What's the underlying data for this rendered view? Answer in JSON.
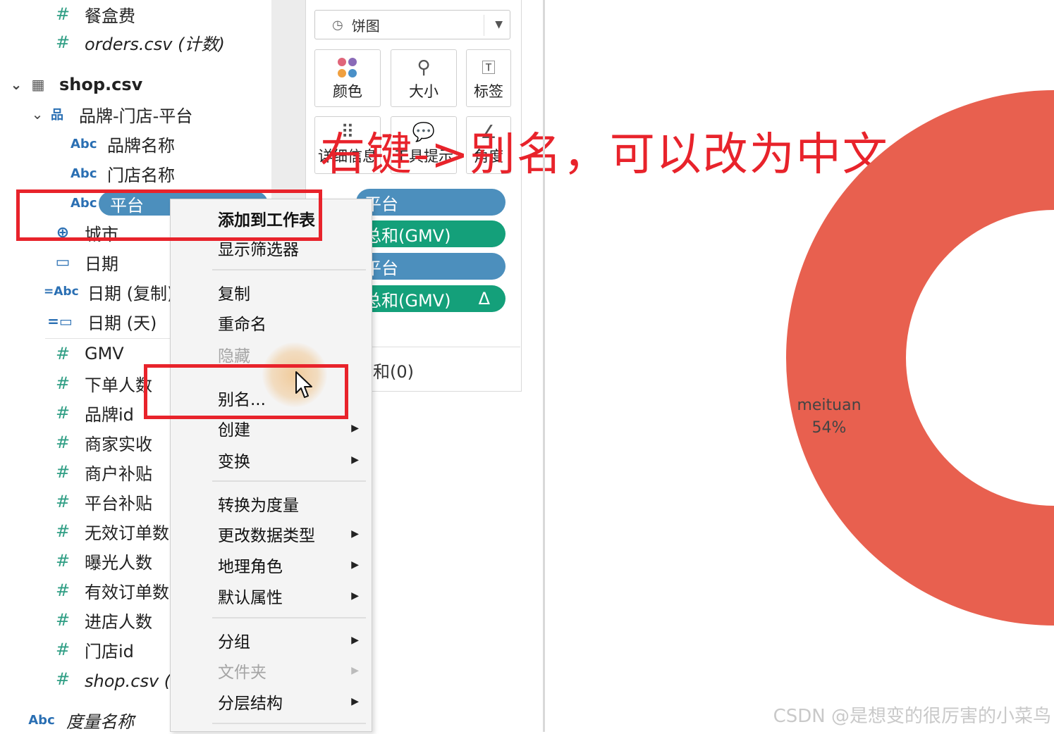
{
  "data_pane": {
    "fields_top": [
      {
        "icon": "#",
        "label": "餐盒费"
      },
      {
        "icon": "#",
        "label": "orders.csv (计数)",
        "italic": true
      }
    ],
    "table_name": "shop.csv",
    "hierarchy_name": "品牌-门店-平台",
    "hierarchy_fields": [
      {
        "icon": "Abc",
        "label": "品牌名称"
      },
      {
        "icon": "Abc",
        "label": "门店名称"
      },
      {
        "icon": "Abc",
        "label": "平台"
      }
    ],
    "dimension_fields": [
      {
        "icon": "globe",
        "label": "城市"
      },
      {
        "icon": "calendar",
        "label": "日期"
      },
      {
        "icon": "=Abc",
        "label": "日期 (复制)"
      },
      {
        "icon": "=calendar",
        "label": "日期 (天)"
      }
    ],
    "measure_fields": [
      {
        "icon": "#",
        "label": "GMV"
      },
      {
        "icon": "#",
        "label": "下单人数"
      },
      {
        "icon": "#",
        "label": "品牌id"
      },
      {
        "icon": "#",
        "label": "商家实收"
      },
      {
        "icon": "#",
        "label": "商户补贴"
      },
      {
        "icon": "#",
        "label": "平台补贴"
      },
      {
        "icon": "#",
        "label": "无效订单数"
      },
      {
        "icon": "#",
        "label": "曝光人数"
      },
      {
        "icon": "#",
        "label": "有效订单数"
      },
      {
        "icon": "#",
        "label": "进店人数"
      },
      {
        "icon": "#",
        "label": "门店id"
      },
      {
        "icon": "#",
        "label": "shop.csv (计",
        "italic": true
      }
    ],
    "measure_names": {
      "icon": "Abc",
      "label": "度量名称"
    }
  },
  "marks": {
    "type_label": "饼图",
    "buttons": [
      {
        "icon": "color-dots",
        "label": "颜色"
      },
      {
        "icon": "size",
        "label": "大小"
      },
      {
        "icon": "T",
        "label": "标签"
      },
      {
        "icon": "detail",
        "label": "详细信息"
      },
      {
        "icon": "tooltip",
        "label": "工具提示"
      },
      {
        "icon": "angle",
        "label": "角度"
      }
    ],
    "pills": [
      {
        "label": "平台",
        "color": "blue"
      },
      {
        "label": "总和(GMV)",
        "color": "green"
      },
      {
        "label": "平台",
        "color": "blue"
      },
      {
        "label": "总和(GMV)",
        "color": "green",
        "delta": "Δ"
      }
    ],
    "bottom_text": "总和(0)"
  },
  "context_menu": {
    "items": [
      {
        "label": "添加到工作表",
        "bold": true
      },
      {
        "label": "显示筛选器"
      },
      {
        "label": "复制"
      },
      {
        "label": "重命名"
      },
      {
        "label": "隐藏",
        "disabled": true
      },
      {
        "label": "别名..."
      },
      {
        "label": "创建",
        "submenu": true
      },
      {
        "label": "变换",
        "submenu": true
      },
      {
        "label": "转换为度量"
      },
      {
        "label": "更改数据类型",
        "submenu": true
      },
      {
        "label": "地理角色",
        "submenu": true
      },
      {
        "label": "默认属性",
        "submenu": true
      },
      {
        "label": "分组",
        "submenu": true
      },
      {
        "label": "文件夹",
        "submenu": true,
        "disabled": true
      },
      {
        "label": "分层结构",
        "submenu": true
      }
    ]
  },
  "annotation_text": "右键->别名，可以改为中文",
  "view": {
    "slice_name": "meituan",
    "slice_percent": "54%",
    "slice_color": "#e8604f"
  },
  "watermark": "CSDN @是想变的很厉害的小菜鸟",
  "colors": {
    "accent_red": "#e8232b",
    "pill_blue": "#4c8fbd",
    "pill_green": "#14a07a"
  }
}
